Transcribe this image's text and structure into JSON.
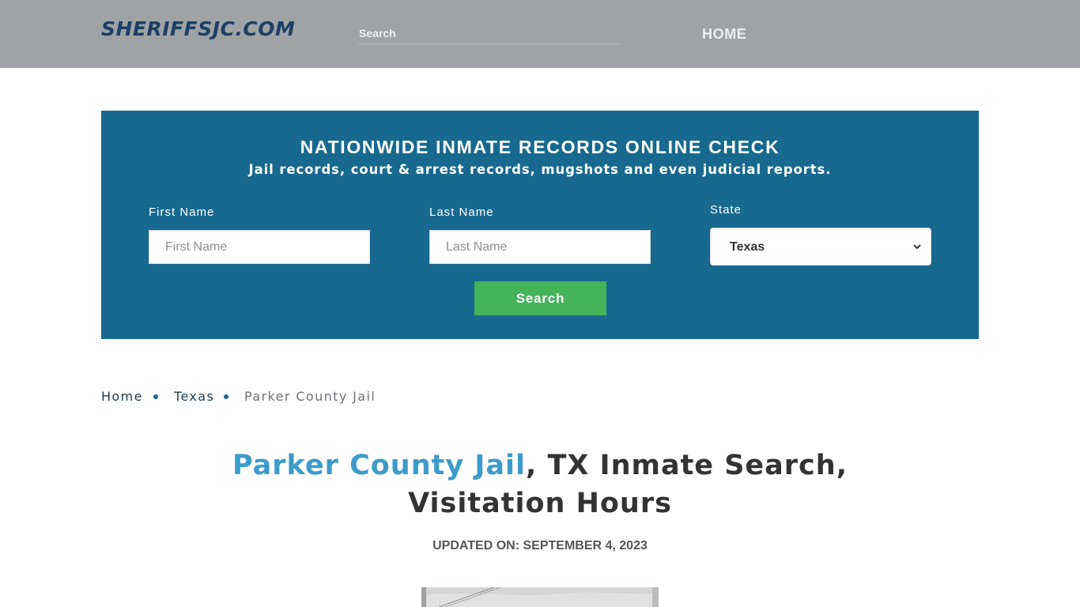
{
  "header": {
    "logo": "SHERIFFSJC.COM",
    "search_placeholder": "Search",
    "nav_home": "HOME"
  },
  "banner": {
    "title": "NATIONWIDE INMATE RECORDS ONLINE CHECK",
    "subtitle": "Jail records, court & arrest records, mugshots and even judicial reports.",
    "first_name_label": "First Name",
    "first_name_placeholder": "First Name",
    "last_name_label": "Last Name",
    "last_name_placeholder": "Last Name",
    "state_label": "State",
    "state_value": "Texas",
    "search_button": "Search"
  },
  "breadcrumb": {
    "items": [
      "Home",
      "Texas",
      "Parker County Jail"
    ]
  },
  "main": {
    "title_link": "Parker County Jail",
    "title_rest": ", TX Inmate Search, Visitation Hours",
    "updated": "UPDATED ON: SEPTEMBER 4, 2023"
  },
  "colors": {
    "header_bg": "#9fa3a6",
    "banner_bg": "#17698f",
    "button_bg": "#44b35a",
    "title_link": "#3c9bca"
  }
}
